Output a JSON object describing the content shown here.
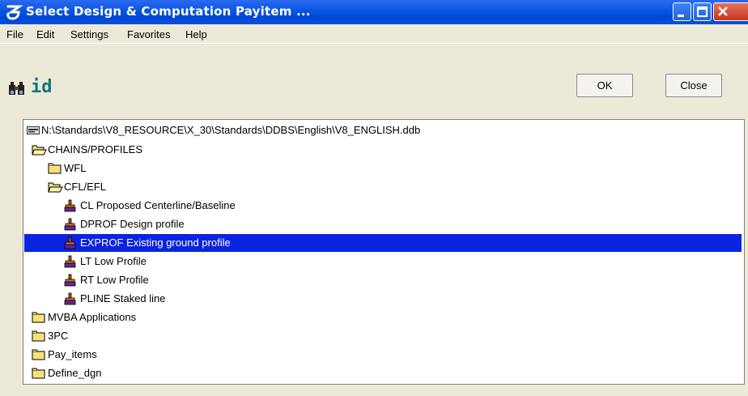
{
  "window": {
    "title": "Select Design & Computation Payitem ..."
  },
  "menu": [
    "File",
    "Edit",
    "Settings",
    "Favorites",
    "Help"
  ],
  "toolbar": {
    "id_label": "id"
  },
  "buttons": {
    "ok": "OK",
    "close": "Close"
  },
  "tree": {
    "root": "N:\\Standards\\V8_RESOURCE\\X_30\\Standards\\DDBS\\English\\V8_ENGLISH.ddb",
    "items": [
      {
        "label": "CHAINS/PROFILES",
        "kind": "folder-open"
      },
      {
        "label": "WFL",
        "kind": "folder"
      },
      {
        "label": "CFL/EFL",
        "kind": "folder-open"
      },
      {
        "label": "CL Proposed Centerline/Baseline",
        "kind": "payitem"
      },
      {
        "label": "DPROF Design profile",
        "kind": "payitem"
      },
      {
        "label": "EXPROF Existing ground profile",
        "kind": "payitem",
        "selected": true
      },
      {
        "label": "LT Low Profile",
        "kind": "payitem"
      },
      {
        "label": "RT Low Profile",
        "kind": "payitem"
      },
      {
        "label": "PLINE Staked line",
        "kind": "payitem"
      },
      {
        "label": "MVBA Applications",
        "kind": "folder"
      },
      {
        "label": "3PC",
        "kind": "folder"
      },
      {
        "label": "Pay_items",
        "kind": "folder"
      },
      {
        "label": "Define_dgn",
        "kind": "folder"
      }
    ]
  },
  "colors": {
    "titlebar": "#0a55e0",
    "selection": "#0a24e0",
    "dialog": "#ece9d8"
  }
}
